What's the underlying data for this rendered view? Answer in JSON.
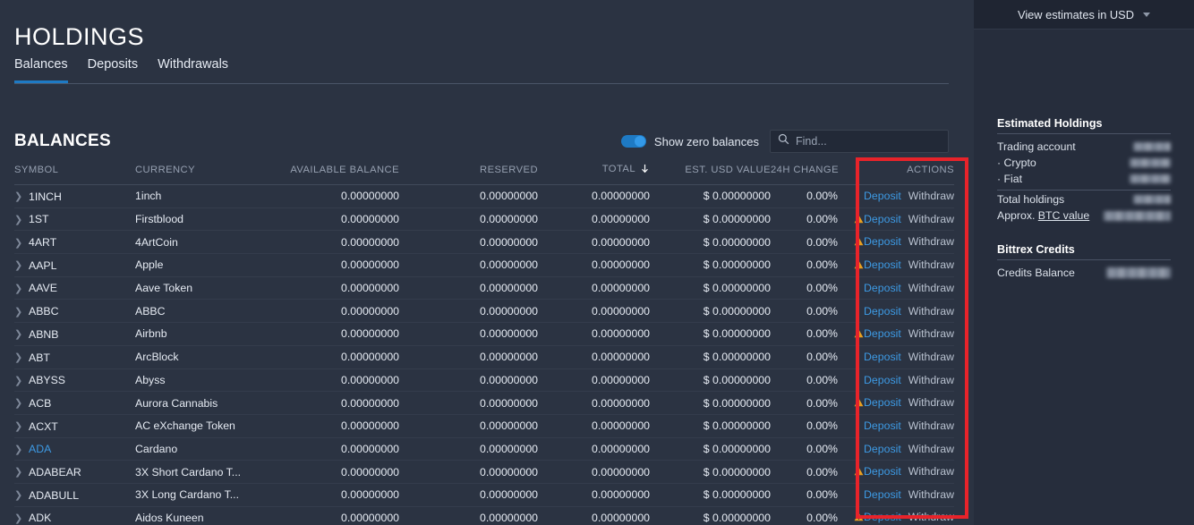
{
  "page": {
    "title": "HOLDINGS",
    "tabs": [
      {
        "label": "Balances",
        "active": true
      },
      {
        "label": "Deposits",
        "active": false
      },
      {
        "label": "Withdrawals",
        "active": false
      }
    ],
    "section_title": "BALANCES"
  },
  "controls": {
    "toggle_label": "Show zero balances",
    "toggle_on": true,
    "search_placeholder": "Find...",
    "search_value": ""
  },
  "table": {
    "columns": [
      {
        "key": "symbol",
        "label": "SYMBOL",
        "align": "left"
      },
      {
        "key": "currency",
        "label": "CURRENCY",
        "align": "left"
      },
      {
        "key": "available",
        "label": "AVAILABLE BALANCE",
        "align": "right"
      },
      {
        "key": "reserved",
        "label": "RESERVED",
        "align": "right"
      },
      {
        "key": "total",
        "label": "TOTAL",
        "align": "right",
        "sorted": "desc"
      },
      {
        "key": "usd",
        "label": "EST. USD VALUE",
        "align": "right"
      },
      {
        "key": "change",
        "label": "24H CHANGE",
        "align": "right"
      },
      {
        "key": "actions",
        "label": "ACTIONS",
        "align": "right"
      }
    ],
    "action_labels": {
      "deposit": "Deposit",
      "withdraw": "Withdraw"
    },
    "rows": [
      {
        "symbol": "1INCH",
        "currency": "1inch",
        "available": "0.00000000",
        "reserved": "0.00000000",
        "total": "0.00000000",
        "usd": "$ 0.00000000",
        "change": "0.00%",
        "warning": false,
        "highlight": false
      },
      {
        "symbol": "1ST",
        "currency": "Firstblood",
        "available": "0.00000000",
        "reserved": "0.00000000",
        "total": "0.00000000",
        "usd": "$ 0.00000000",
        "change": "0.00%",
        "warning": true,
        "highlight": false
      },
      {
        "symbol": "4ART",
        "currency": "4ArtCoin",
        "available": "0.00000000",
        "reserved": "0.00000000",
        "total": "0.00000000",
        "usd": "$ 0.00000000",
        "change": "0.00%",
        "warning": true,
        "highlight": false
      },
      {
        "symbol": "AAPL",
        "currency": "Apple",
        "available": "0.00000000",
        "reserved": "0.00000000",
        "total": "0.00000000",
        "usd": "$ 0.00000000",
        "change": "0.00%",
        "warning": true,
        "highlight": false
      },
      {
        "symbol": "AAVE",
        "currency": "Aave Token",
        "available": "0.00000000",
        "reserved": "0.00000000",
        "total": "0.00000000",
        "usd": "$ 0.00000000",
        "change": "0.00%",
        "warning": false,
        "highlight": false
      },
      {
        "symbol": "ABBC",
        "currency": "ABBC",
        "available": "0.00000000",
        "reserved": "0.00000000",
        "total": "0.00000000",
        "usd": "$ 0.00000000",
        "change": "0.00%",
        "warning": false,
        "highlight": false
      },
      {
        "symbol": "ABNB",
        "currency": "Airbnb",
        "available": "0.00000000",
        "reserved": "0.00000000",
        "total": "0.00000000",
        "usd": "$ 0.00000000",
        "change": "0.00%",
        "warning": true,
        "highlight": false
      },
      {
        "symbol": "ABT",
        "currency": "ArcBlock",
        "available": "0.00000000",
        "reserved": "0.00000000",
        "total": "0.00000000",
        "usd": "$ 0.00000000",
        "change": "0.00%",
        "warning": false,
        "highlight": false
      },
      {
        "symbol": "ABYSS",
        "currency": "Abyss",
        "available": "0.00000000",
        "reserved": "0.00000000",
        "total": "0.00000000",
        "usd": "$ 0.00000000",
        "change": "0.00%",
        "warning": false,
        "highlight": false
      },
      {
        "symbol": "ACB",
        "currency": "Aurora Cannabis",
        "available": "0.00000000",
        "reserved": "0.00000000",
        "total": "0.00000000",
        "usd": "$ 0.00000000",
        "change": "0.00%",
        "warning": true,
        "highlight": false
      },
      {
        "symbol": "ACXT",
        "currency": "AC eXchange Token",
        "available": "0.00000000",
        "reserved": "0.00000000",
        "total": "0.00000000",
        "usd": "$ 0.00000000",
        "change": "0.00%",
        "warning": false,
        "highlight": false
      },
      {
        "symbol": "ADA",
        "currency": "Cardano",
        "available": "0.00000000",
        "reserved": "0.00000000",
        "total": "0.00000000",
        "usd": "$ 0.00000000",
        "change": "0.00%",
        "warning": false,
        "highlight": true
      },
      {
        "symbol": "ADABEAR",
        "currency": "3X Short Cardano T...",
        "available": "0.00000000",
        "reserved": "0.00000000",
        "total": "0.00000000",
        "usd": "$ 0.00000000",
        "change": "0.00%",
        "warning": true,
        "highlight": false
      },
      {
        "symbol": "ADABULL",
        "currency": "3X Long Cardano T...",
        "available": "0.00000000",
        "reserved": "0.00000000",
        "total": "0.00000000",
        "usd": "$ 0.00000000",
        "change": "0.00%",
        "warning": false,
        "highlight": false
      },
      {
        "symbol": "ADK",
        "currency": "Aidos Kuneen",
        "available": "0.00000000",
        "reserved": "0.00000000",
        "total": "0.00000000",
        "usd": "$ 0.00000000",
        "change": "0.00%",
        "warning": true,
        "highlight": false
      }
    ]
  },
  "sidebar": {
    "currency_selector": "View estimates in USD",
    "estimated_holdings": {
      "title": "Estimated Holdings",
      "rows": [
        {
          "label": "Trading account",
          "value_hidden": true
        },
        {
          "label": "· Crypto",
          "value_hidden": true
        },
        {
          "label": "· Fiat",
          "value_hidden": true
        },
        {
          "label": "Total holdings",
          "value_hidden": true
        },
        {
          "label": "Approx. BTC value",
          "value_hidden": true
        }
      ]
    },
    "bittrex_credits": {
      "title": "Bittrex Credits",
      "rows": [
        {
          "label": "Credits Balance",
          "value_hidden": true
        }
      ]
    }
  },
  "annotation": {
    "target": "actions-column",
    "color": "#e8232a"
  }
}
